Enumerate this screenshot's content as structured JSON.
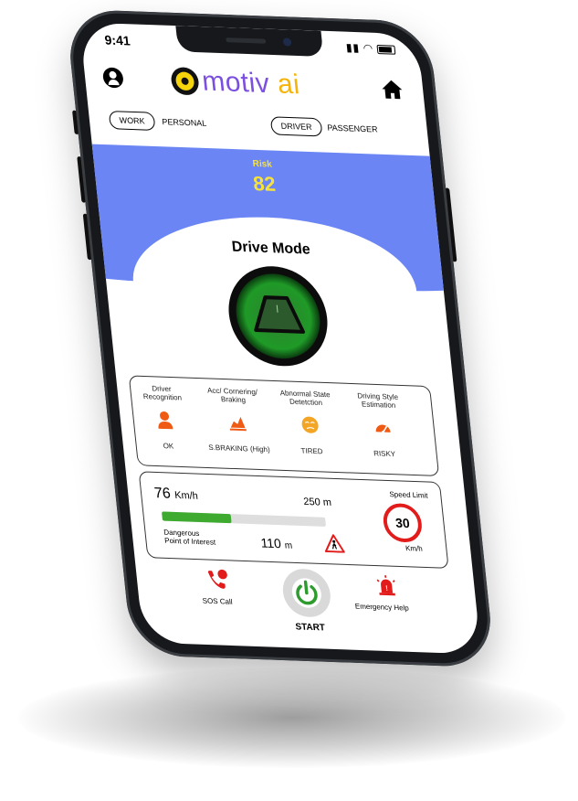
{
  "status_bar": {
    "time": "9:41"
  },
  "header": {
    "logo_text": "motiv",
    "logo_ai": "ai"
  },
  "toggles": {
    "work": "WORK",
    "personal": "PERSONAL",
    "driver": "DRIVER",
    "passenger": "PASSENGER"
  },
  "risk": {
    "label": "Risk",
    "value": "82"
  },
  "drive": {
    "title": "Drive Mode"
  },
  "modules": [
    {
      "head": "Driver Recognition",
      "status": "OK",
      "icon": "person-icon",
      "color": "#ef5a14"
    },
    {
      "head": "Acc/ Cornering/ Braking",
      "status": "S.BRAKING (High)",
      "icon": "car-braking-icon",
      "color": "#ef5a14"
    },
    {
      "head": "Abnormal State Detetction",
      "status": "TIRED",
      "icon": "tired-face-icon",
      "color": "#f3a526"
    },
    {
      "head": "Driving Style Estimation",
      "status": "RISKY",
      "icon": "speedometer-icon",
      "color": "#ef5a14"
    }
  ],
  "speed": {
    "value": "76",
    "unit": "Km/h",
    "distance": "250 m",
    "progress": 0.42,
    "dpi_label_1": "Dangerous",
    "dpi_label_2": "Point of Interest",
    "dpi_value": "110",
    "dpi_unit": "m",
    "limit_label": "Speed Limit",
    "limit_value": "30",
    "limit_unit": "Km/h"
  },
  "actions": {
    "sos": "SOS Call",
    "start": "START",
    "emergency": "Emergency Help"
  },
  "colors": {
    "accent_blue": "#6b86f4",
    "risk_yellow": "#f7e23b",
    "green": "#3eaa2f",
    "red": "#e21b1b"
  }
}
